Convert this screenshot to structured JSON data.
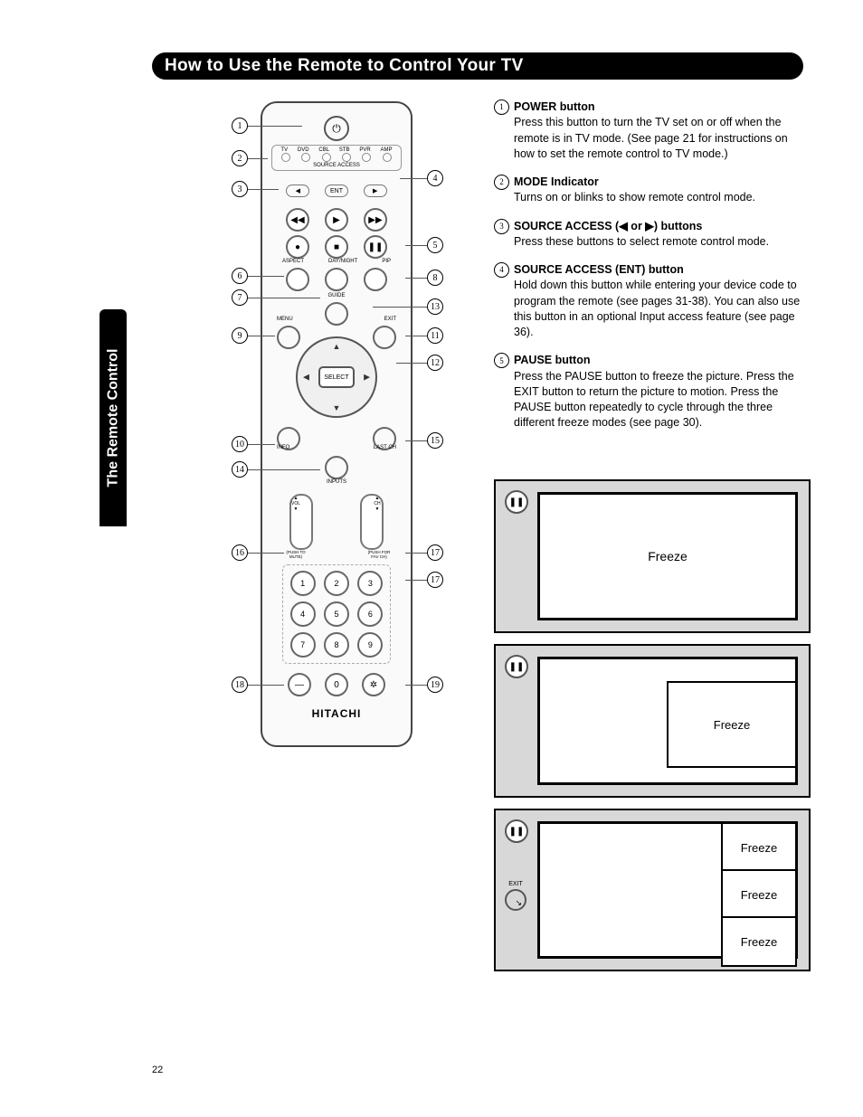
{
  "header": {
    "title": "How to Use the Remote to Control Your TV"
  },
  "side_tab": "The Remote Control",
  "page_number": "22",
  "remote": {
    "modes": [
      "TV",
      "DVD",
      "CBL",
      "STB",
      "PVR",
      "AMP"
    ],
    "source_access_label": "SOURCE ACCESS",
    "ent": "ENT",
    "row_labels": [
      "ASPECT",
      "DAY/NIGHT",
      "PIP"
    ],
    "guide": "GUIDE",
    "menu": "MENU",
    "exit": "EXIT",
    "select": "SELECT",
    "info": "INFO",
    "lastch": "LAST CH",
    "inputs": "INPUTS",
    "vol_label": "▲\nVOL\n▼",
    "vol_note": "(PUSH TO MUTE)",
    "ch_label": "▲\nCH\n▼",
    "ch_note": "(PUSH FOR FAV CH)",
    "numpad": [
      "1",
      "2",
      "3",
      "4",
      "5",
      "6",
      "7",
      "8",
      "9",
      "—",
      "0",
      "✲"
    ],
    "brand": "HITACHI"
  },
  "callouts_left": [
    "1",
    "2",
    "3",
    "6",
    "7",
    "9",
    "10",
    "14",
    "16",
    "18"
  ],
  "callouts_right": [
    "4",
    "5",
    "8",
    "13",
    "11",
    "12",
    "15",
    "17",
    "17",
    "19"
  ],
  "descriptions": [
    {
      "n": "1",
      "title": "POWER button",
      "text": "Press this button to turn the TV set on or off when the remote is in TV mode.  (See page 21 for instructions on how to set the remote control to TV mode.)"
    },
    {
      "n": "2",
      "title": "MODE Indicator",
      "text": "Turns on or blinks to show remote control mode."
    },
    {
      "n": "3",
      "title": "SOURCE ACCESS (◀ or ▶) buttons",
      "text": "Press these buttons to select remote control mode."
    },
    {
      "n": "4",
      "title": "SOURCE ACCESS (ENT) button",
      "text": "Hold down this button while entering your device code to program the remote (see pages 31-38). You can also use this button in an optional Input access feature (see page 36)."
    },
    {
      "n": "5",
      "title": "PAUSE button",
      "text": "Press the PAUSE button to freeze the picture. Press the EXIT button to return the picture to motion.  Press the PAUSE button repeatedly to cycle through the three different freeze modes (see page 30)."
    }
  ],
  "freeze": {
    "label": "Freeze",
    "exit": "EXIT"
  }
}
